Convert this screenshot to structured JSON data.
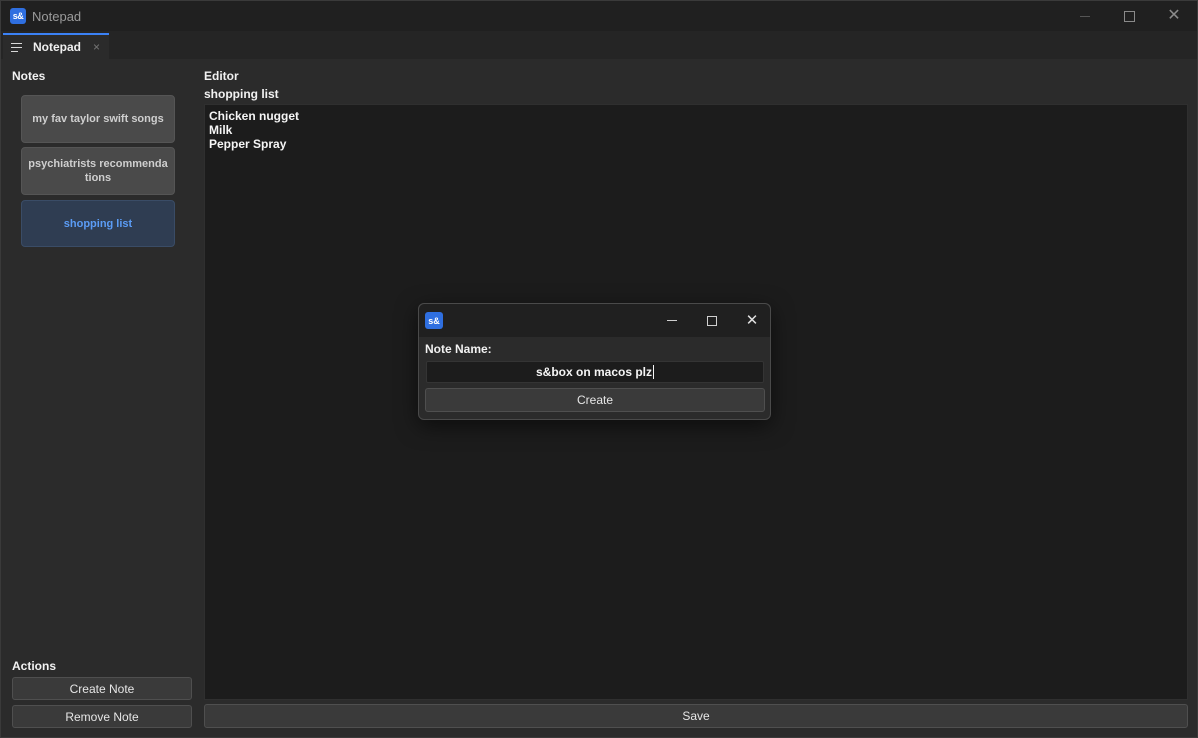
{
  "window": {
    "logo_text": "s&",
    "title": "Notepad"
  },
  "tab": {
    "label": "Notepad",
    "close_symbol": "×"
  },
  "notes_panel": {
    "title": "Notes",
    "items": [
      {
        "label": "my fav taylor swift songs",
        "active": false
      },
      {
        "label": "psychiatrists recommendations",
        "active": false
      },
      {
        "label": "shopping list",
        "active": true
      }
    ]
  },
  "actions_panel": {
    "title": "Actions",
    "create_label": "Create Note",
    "remove_label": "Remove Note"
  },
  "editor": {
    "title": "Editor",
    "note_name": "shopping list",
    "lines": [
      "Chicken nugget",
      "Milk",
      "Pepper Spray"
    ],
    "save_label": "Save"
  },
  "dialog": {
    "logo_text": "s&",
    "field_label": "Note Name:",
    "field_value": "s&box on macos plz",
    "create_label": "Create"
  },
  "colors": {
    "accent": "#3b82f6",
    "active_note_text": "#5b9cf5",
    "logo_bg": "#2f6fe0"
  }
}
